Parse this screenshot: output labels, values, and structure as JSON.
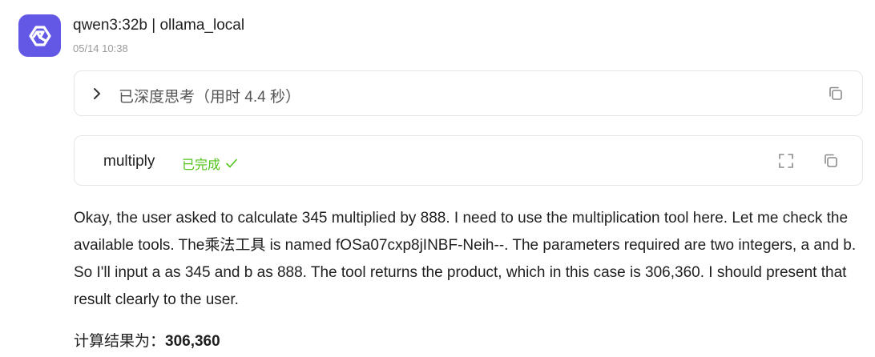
{
  "message": {
    "model_label": "qwen3:32b | ollama_local",
    "timestamp": "05/14 10:38",
    "avatar_icon": "qwen-logo-icon",
    "accent_color": "#6358e6"
  },
  "thinking": {
    "label": "已深度思考（用时 4.4 秒）",
    "expand_icon": "chevron-right-icon",
    "copy_icon": "copy-icon"
  },
  "tool_call": {
    "name": "multiply",
    "status": "已完成",
    "status_icon": "check-icon",
    "status_color": "#52c41a",
    "expand_icon": "fullscreen-icon",
    "copy_icon": "copy-icon"
  },
  "content": {
    "paragraph": "Okay, the user asked to calculate 345 multiplied by 888. I need to use the multiplication tool here. Let me check the available tools. The乘法工具 is named fOSa07cxp8jINBF-Neih--. The parameters required are two integers, a and b. So I'll input a as 345 and b as 888. The tool returns the product, which in this case is 306,360. I should present that result clearly to the user.",
    "result_label": "计算结果为：",
    "result_value": "306,360"
  }
}
